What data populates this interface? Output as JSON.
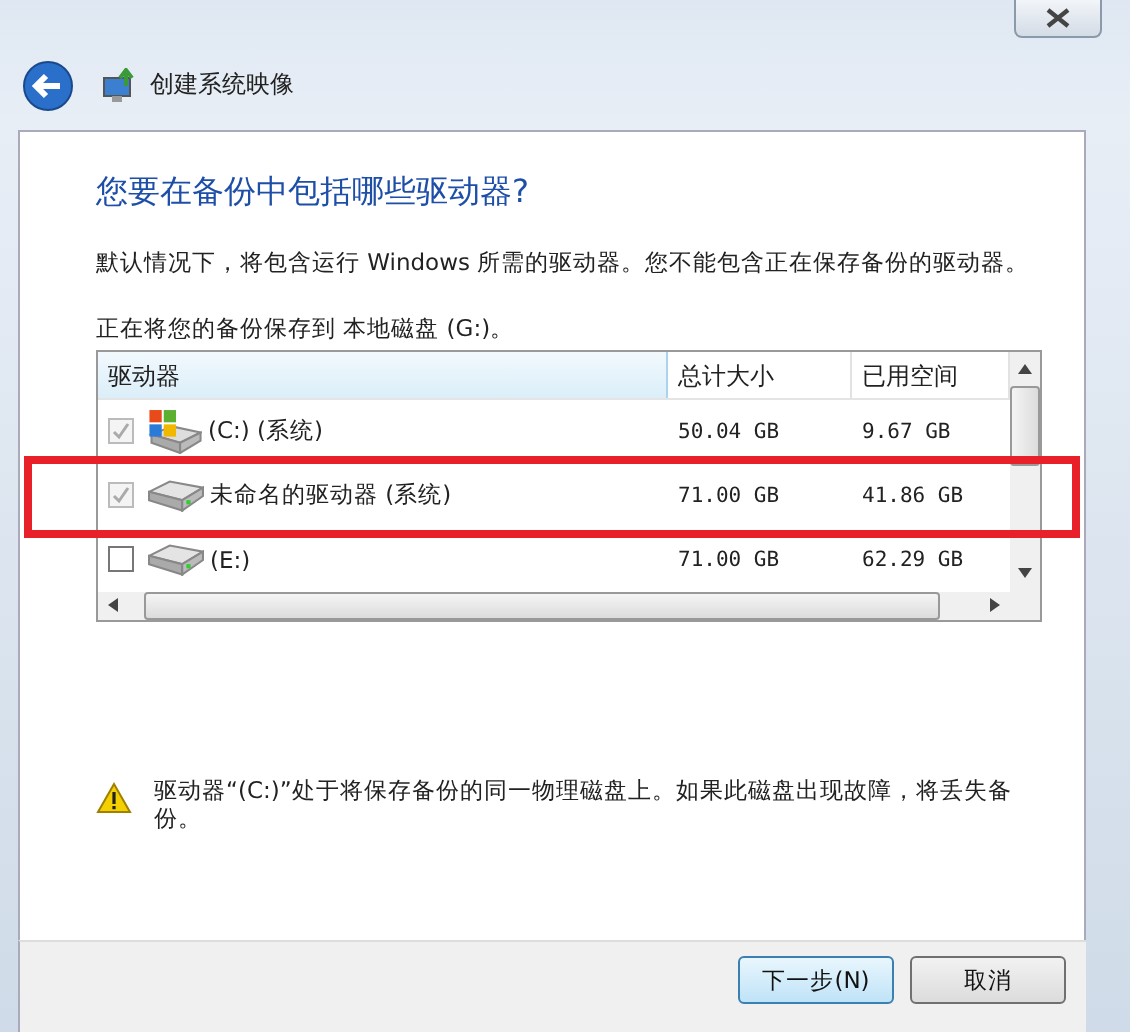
{
  "window": {
    "title": "创建系统映像"
  },
  "heading": "您要在备份中包括哪些驱动器?",
  "description": "默认情况下，将包含运行 Windows 所需的驱动器。您不能包含正在保存备份的驱动器。",
  "save_location": "正在将您的备份保存到 本地磁盘 (G:)。",
  "table": {
    "columns": [
      "驱动器",
      "总计大小",
      "已用空间"
    ],
    "rows": [
      {
        "name": "(C:) (系统)",
        "kind": "system",
        "checked": true,
        "disabled": true,
        "total": "50.04 GB",
        "used": "9.67 GB",
        "highlighted": false
      },
      {
        "name": "未命名的驱动器 (系统)",
        "kind": "plain",
        "checked": true,
        "disabled": true,
        "total": "71.00 GB",
        "used": "41.86 GB",
        "highlighted": true
      },
      {
        "name": "(E:)",
        "kind": "plain",
        "checked": false,
        "disabled": false,
        "total": "71.00 GB",
        "used": "62.29 GB",
        "highlighted": false
      }
    ]
  },
  "warning": "驱动器“(C:)”处于将保存备份的同一物理磁盘上。如果此磁盘出现故障，将丢失备份。",
  "buttons": [
    "下一步(N)",
    "取消"
  ]
}
